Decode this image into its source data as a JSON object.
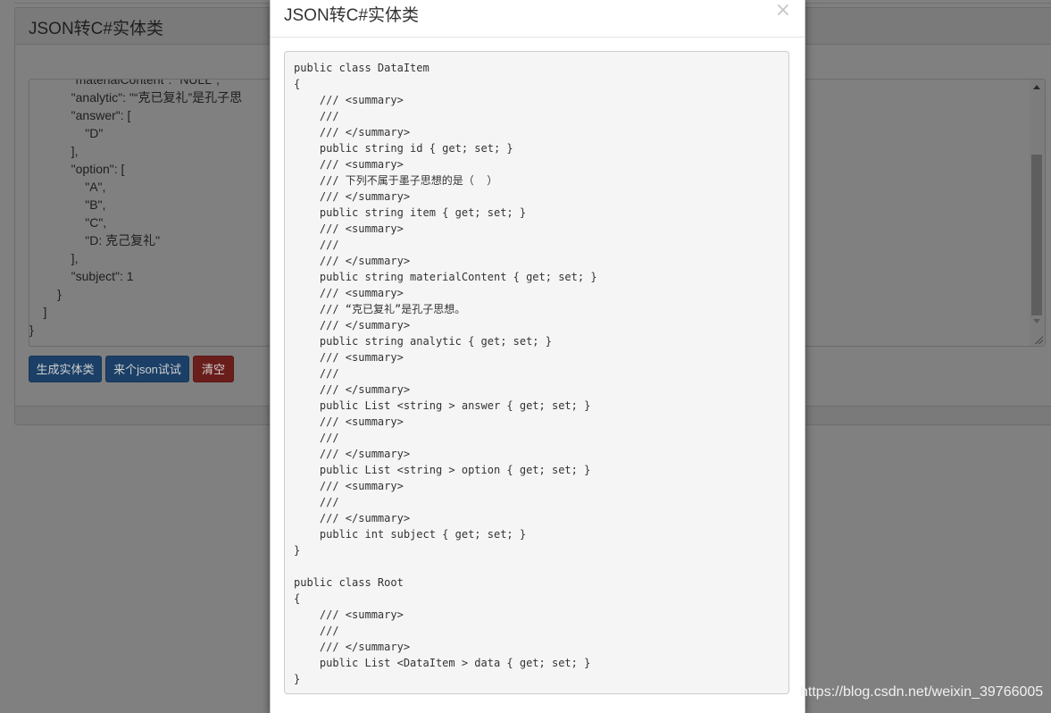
{
  "panel": {
    "title": "JSON转C#实体类"
  },
  "json_input": {
    "lines": [
      "            \"materialContent\": \"NULL\",",
      "            \"analytic\": \"“克已复礼”是孔子思",
      "            \"answer\": [",
      "                \"D\"",
      "            ],",
      "            \"option\": [",
      "                \"A\",",
      "                \"B\",",
      "                \"C\",",
      "                \"D: 克己复礼\"",
      "            ],",
      "            \"subject\": 1",
      "        }",
      "    ]",
      "}"
    ]
  },
  "buttons": {
    "generate": "生成实体类",
    "try_json": "来个json试试",
    "clear": "清空"
  },
  "modal": {
    "title": "JSON转C#实体类",
    "close_symbol": "×",
    "code_lines": [
      "public class DataItem",
      "{",
      "    /// <summary>",
      "    ///",
      "    /// </summary>",
      "    public string id { get; set; }",
      "    /// <summary>",
      "    /// 下列不属于墨子思想的是（  ）",
      "    /// </summary>",
      "    public string item { get; set; }",
      "    /// <summary>",
      "    ///",
      "    /// </summary>",
      "    public string materialContent { get; set; }",
      "    /// <summary>",
      "    /// “克已复礼”是孔子思想。",
      "    /// </summary>",
      "    public string analytic { get; set; }",
      "    /// <summary>",
      "    ///",
      "    /// </summary>",
      "    public List <string > answer { get; set; }",
      "    /// <summary>",
      "    ///",
      "    /// </summary>",
      "    public List <string > option { get; set; }",
      "    /// <summary>",
      "    ///",
      "    /// </summary>",
      "    public int subject { get; set; }",
      "}",
      "",
      "public class Root",
      "{",
      "    /// <summary>",
      "    ///",
      "    /// </summary>",
      "    public List <DataItem > data { get; set; }",
      "}"
    ]
  },
  "watermark": "https://blog.csdn.net/weixin_39766005",
  "colors": {
    "backdrop": "#808080",
    "primary_button_dimmed": "#1b3f66",
    "danger_button_dimmed": "#6a1e1c",
    "code_background": "#f5f5f5"
  },
  "icons": [
    "close-icon",
    "scroll-up-arrow-icon",
    "scroll-down-arrow-icon",
    "resize-grip-icon"
  ]
}
